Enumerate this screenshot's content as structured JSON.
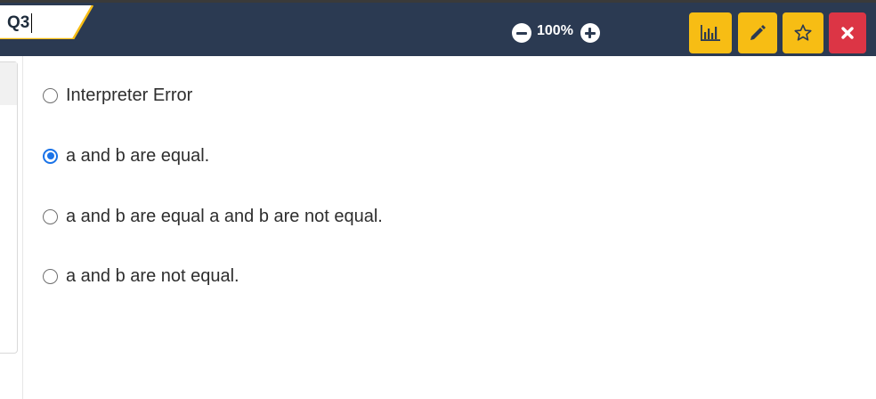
{
  "question_tab": {
    "label": "Q3"
  },
  "zoom": {
    "value": "100%"
  },
  "toolbar": {
    "stats_icon": "bar-chart-icon",
    "edit_icon": "pencil-icon",
    "bookmark_icon": "star-icon",
    "close_icon": "close-icon",
    "accent_color": "#f7bd14",
    "close_color": "#dc3545",
    "bar_color": "#2b3a52"
  },
  "options": [
    {
      "label": "Interpreter Error",
      "selected": false
    },
    {
      "label": "a and b are equal.",
      "selected": true
    },
    {
      "label": "a and b are equal a and b are not equal.",
      "selected": false
    },
    {
      "label": "a and b are not equal.",
      "selected": false
    }
  ]
}
